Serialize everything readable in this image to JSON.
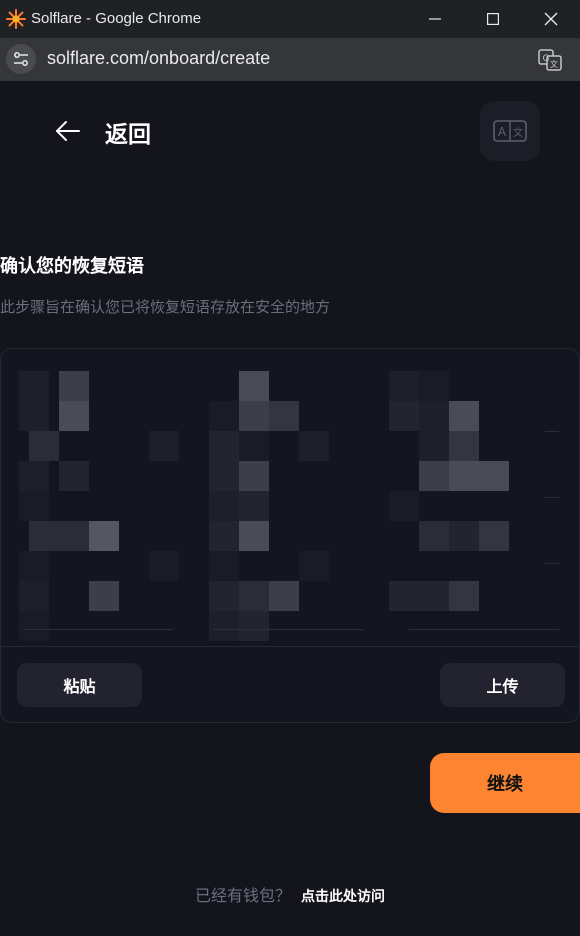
{
  "window": {
    "title": "Solflare - Google Chrome"
  },
  "browser": {
    "url": "solflare.com/onboard/create"
  },
  "header": {
    "back_label": "返回"
  },
  "main": {
    "title": "确认您的恢复短语",
    "subtitle": "此步骤旨在确认您已将恢复短语存放在安全的地方",
    "paste_label": "粘贴",
    "upload_label": "上传",
    "continue_label": "继续"
  },
  "footer": {
    "question": "已经有钱包？",
    "link_label": "点击此处访问"
  },
  "colors": {
    "background": "#13141c",
    "accent": "#fd8431",
    "muted_text": "#6b6e7d",
    "button_bg": "#22232e"
  },
  "icons": {
    "app": "solflare-sun-icon",
    "back": "arrow-left-icon",
    "language": "translate-icon",
    "site_info": "tune-icon"
  }
}
